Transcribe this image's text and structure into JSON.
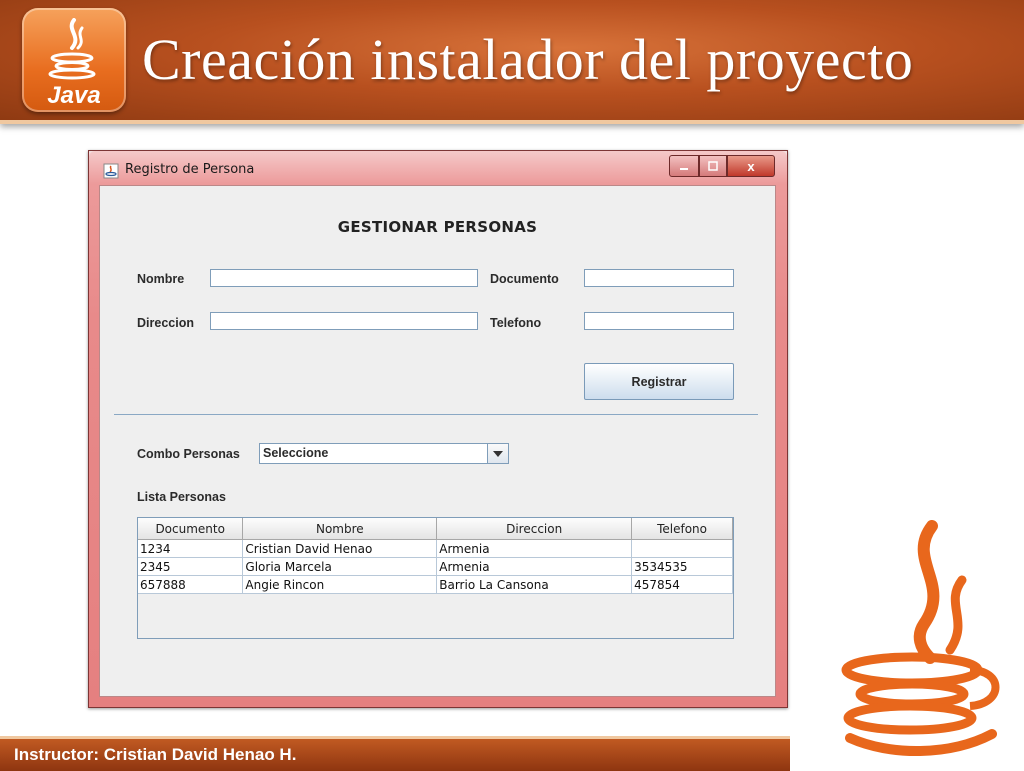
{
  "slide": {
    "title": "Creación instalador del proyecto",
    "logo_text": "Java",
    "footer": "Instructor: Cristian David Henao H."
  },
  "window": {
    "title": "Registro de Persona",
    "controls": {
      "close": "x"
    }
  },
  "form": {
    "heading": "GESTIONAR PERSONAS",
    "nombre_label": "Nombre",
    "nombre_value": "",
    "documento_label": "Documento",
    "documento_value": "",
    "direccion_label": "Direccion",
    "direccion_value": "",
    "telefono_label": "Telefono",
    "telefono_value": "",
    "register_button": "Registrar"
  },
  "combo": {
    "label": "Combo Personas",
    "selected": "Seleccione"
  },
  "list": {
    "label": "Lista Personas",
    "columns": [
      "Documento",
      "Nombre",
      "Direccion",
      "Telefono"
    ],
    "rows": [
      [
        "1234",
        "Cristian David Henao",
        "Armenia",
        ""
      ],
      [
        "2345",
        "Gloria Marcela",
        "Armenia",
        "3534535"
      ],
      [
        "657888",
        "Angie Rincon",
        "Barrio La Cansona",
        "457854"
      ]
    ]
  },
  "colors": {
    "header_brown": "#b8501f",
    "java_orange": "#e86d1f",
    "window_frame": "#e58080",
    "field_border": "#7f9db9"
  }
}
